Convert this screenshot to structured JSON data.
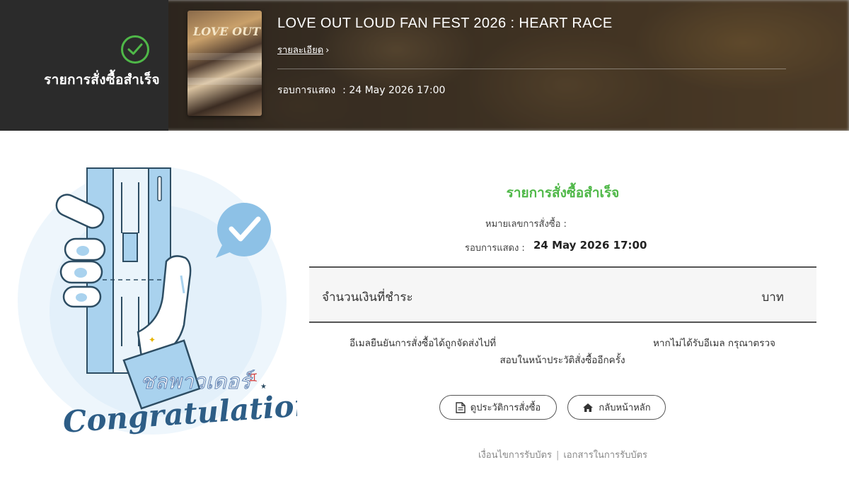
{
  "header": {
    "status_text": "รายการสั่งซื้อสำเร็จ",
    "event_title": "LOVE OUT LOUD FAN FEST 2026 : HEART RACE",
    "detail_link": "รายละเอียด",
    "showtime_label": "รอบการแสดง",
    "showtime_value": ": 24 May 2026 17:00",
    "poster_text": "LOVE OUT"
  },
  "illustration": {
    "script_text": "Congratulations",
    "overlay_text": "ชลพาวเดอร์",
    "icon": "hand-holding-ticket-icon"
  },
  "main": {
    "title": "รายการสั่งซื้อสำเร็จ",
    "order_no_label": "หมายเลขการสั่งซื้อ :",
    "showtime_label": "รอบการแสดง :",
    "showtime_value": "24 May 2026 17:00",
    "amount_label": "จำนวนเงินที่ชำระ",
    "amount_unit": "บาท",
    "email_note_part1": "อีเมลยืนยันการสั่งซื้อได้ถูกจัดส่งไปที่",
    "email_note_part2": "หากไม่ได้รับอีเมล กรุณาตรวจ",
    "email_note_line2": "สอบในหน้าประวัติสั่งซื้ออีกครั้ง",
    "history_button": "ดูประวัติการสั่งซื้อ",
    "home_button": "กลับหน้าหลัก"
  },
  "footer": {
    "terms_link": "เงื่อนไขการรับบัตร",
    "docs_link": "เอกสารในการรับบัตร"
  },
  "colors": {
    "accent_green": "#4fb848",
    "illustration_blue": "#a9d2ee",
    "text_dark": "#333333"
  }
}
